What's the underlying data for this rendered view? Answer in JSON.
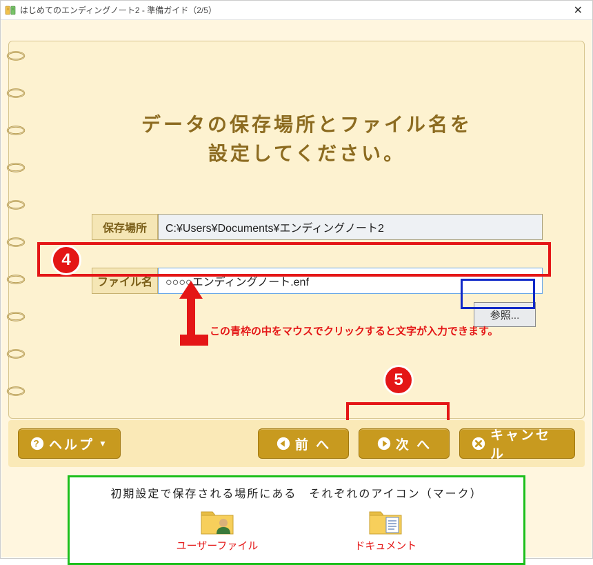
{
  "window_title": "はじめてのエンディングノート2 - 準備ガイド（2/5）",
  "heading_line1": "データの保存場所とファイル名を",
  "heading_line2": "設定してください。",
  "labels": {
    "save_location": "保存場所",
    "file_name": "ファイル名"
  },
  "values": {
    "save_location": "C:¥Users¥Documents¥エンディングノート2",
    "file_name": "○○○○エンディングノート.enf"
  },
  "browse_button": "参照...",
  "buttons": {
    "help": "ヘルプ",
    "prev": "前 へ",
    "next": "次 へ",
    "cancel": "キャンセル"
  },
  "annotations": {
    "step4": "4",
    "step5": "5",
    "hint": "この青枠の中をマウスでクリックすると文字が入力できます。"
  },
  "info": {
    "title": "初期設定で保存される場所にある　それぞれのアイコン（マーク）",
    "user_file": "ユーザーファイル",
    "documents": "ドキュメント"
  }
}
